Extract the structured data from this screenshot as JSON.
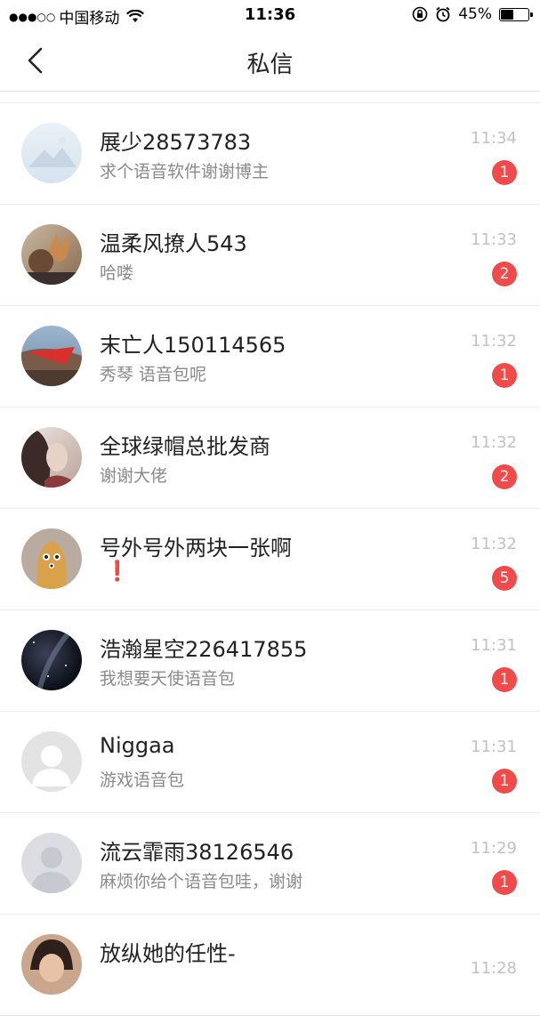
{
  "status_bar": {
    "signal_dots": "●●●○○",
    "carrier": "中国移动",
    "time": "11:36",
    "battery": "45%"
  },
  "nav": {
    "title": "私信"
  },
  "conversations": [
    {
      "name": "展少28573783",
      "message": "求个语音软件谢谢博主",
      "time": "11:34",
      "unread": "1"
    },
    {
      "name": "温柔风撩人543",
      "message": "哈喽",
      "time": "11:33",
      "unread": "2"
    },
    {
      "name": "末亡人150114565",
      "message": "秀琴 语音包呢",
      "time": "11:32",
      "unread": "1"
    },
    {
      "name": "全球绿帽总批发商",
      "message": "谢谢大佬",
      "time": "11:32",
      "unread": "2"
    },
    {
      "name": "号外号外两块一张啊",
      "message": "❗",
      "time": "11:32",
      "unread": "5"
    },
    {
      "name": "浩瀚星空226417855",
      "message": "我想要天使语音包",
      "time": "11:31",
      "unread": "1"
    },
    {
      "name": "Niggaa",
      "message": "游戏语音包",
      "time": "11:31",
      "unread": "1"
    },
    {
      "name": "流云霏雨38126546",
      "message": "麻烦你给个语音包哇，谢谢",
      "time": "11:29",
      "unread": "1"
    },
    {
      "name": "放纵她的任性-",
      "message": "",
      "time": "11:28",
      "unread": ""
    }
  ],
  "colors": {
    "badge": "#f04a4a",
    "time": "#c2c2c2",
    "preview": "#8a8a8a"
  }
}
